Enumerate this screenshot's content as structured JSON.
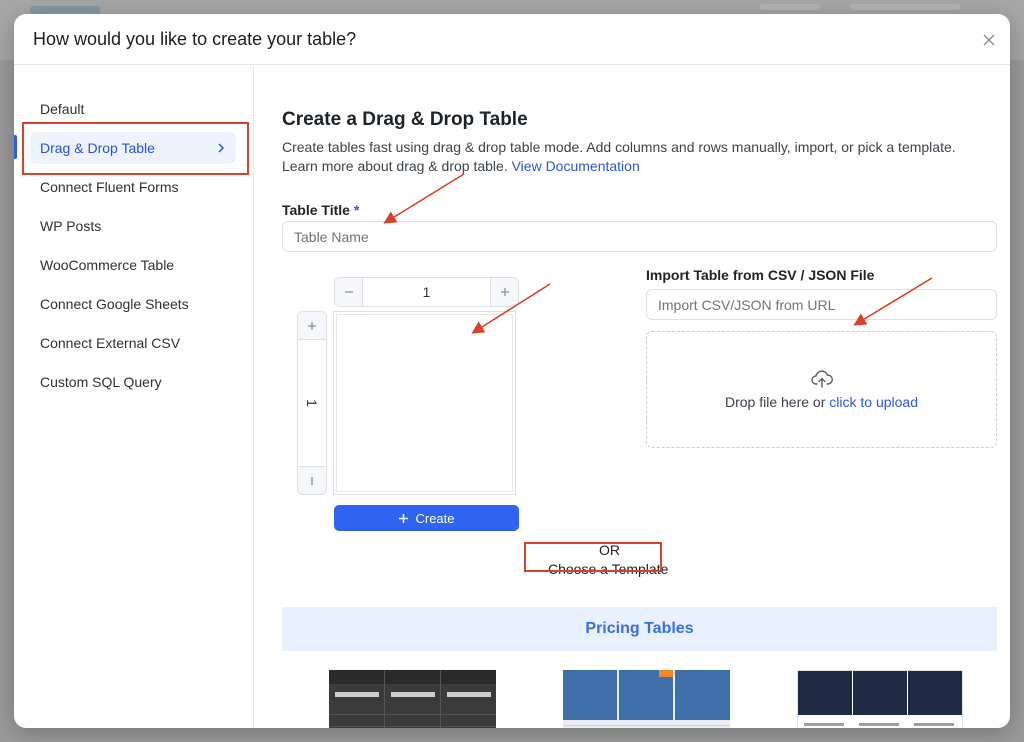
{
  "dialog": {
    "title": "How would you like to create your table?"
  },
  "sidebar": {
    "items": [
      {
        "label": "Default"
      },
      {
        "label": "Drag & Drop Table"
      },
      {
        "label": "Connect Fluent Forms"
      },
      {
        "label": "WP Posts"
      },
      {
        "label": "WooCommerce Table"
      },
      {
        "label": "Connect Google Sheets"
      },
      {
        "label": "Connect External CSV"
      },
      {
        "label": "Custom SQL Query"
      }
    ],
    "active_index": 1
  },
  "main": {
    "heading": "Create a Drag & Drop Table",
    "description": "Create tables fast using drag & drop table mode. Add columns and rows manually, import, or pick a template. Learn more about drag & drop table.",
    "doc_link": "View Documentation",
    "table_title_label": "Table Title",
    "required_mark": "*",
    "table_name_placeholder": "Table Name",
    "columns_value": "1",
    "rows_value": "1",
    "create_label": "Create",
    "import_label": "Import Table from CSV / JSON File",
    "import_url_placeholder": "Import CSV/JSON from URL",
    "drop_text": "Drop file here or",
    "upload_link": "click to upload",
    "or_text": "OR",
    "choose_template": "Choose a Template",
    "pricing_title": "Pricing Tables"
  },
  "colors": {
    "accent": "#2f63f0",
    "annotation": "#d9412a"
  }
}
